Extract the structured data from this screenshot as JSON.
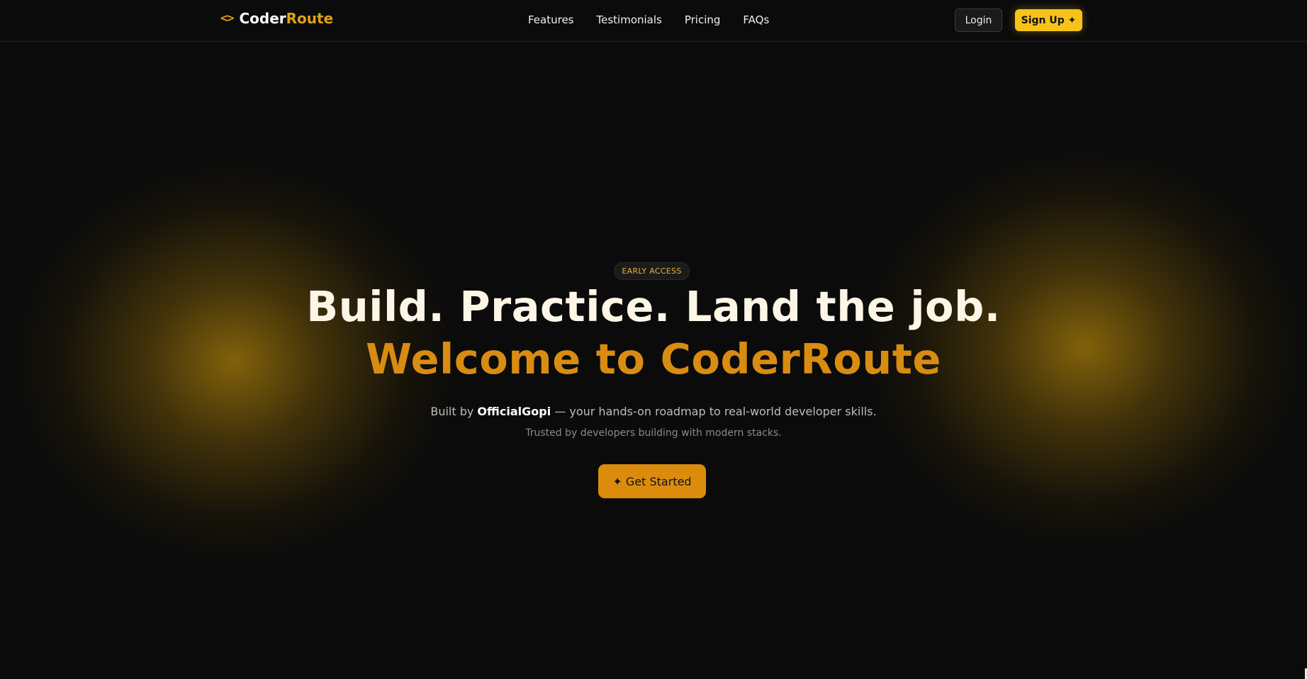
{
  "nav": {
    "logo_icon": "<>",
    "logo_part1": "Coder",
    "logo_part2": "Route",
    "links": [
      "Features",
      "Testimonials",
      "Pricing",
      "FAQs"
    ],
    "login_label": "Login",
    "signup_label": "Sign Up ✦"
  },
  "hero": {
    "badge": "EARLY ACCESS",
    "headline": "Build. Practice. Land the job.",
    "subheadline": "Welcome to CoderRoute",
    "lead_prefix": "Built by ",
    "lead_author": "OfficialGopi",
    "lead_suffix": " — your hands-on roadmap to real-world developer skills.",
    "trust": "Trusted by developers building with modern stacks.",
    "cta_label": "✦ Get Started"
  },
  "colors": {
    "background": "#0b0b0b",
    "accent": "#e0a114",
    "signup": "#f7c21a",
    "cta": "#dc8c0c",
    "headline": "#fdf6e6",
    "subheadline": "#d98c12"
  },
  "icons": {
    "logo": "code-brackets-icon",
    "sparkle": "sparkle-icon"
  }
}
